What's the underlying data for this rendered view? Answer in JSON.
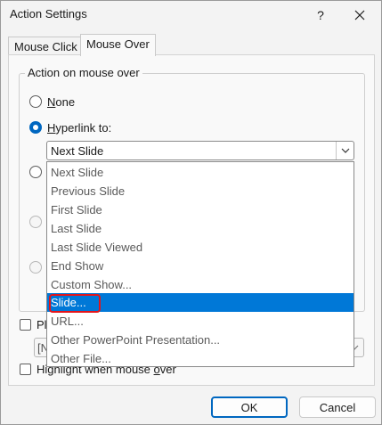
{
  "window": {
    "title": "Action Settings",
    "help_icon": "question-mark-icon",
    "close_icon": "close-icon"
  },
  "tabs": [
    {
      "label": "Mouse Click",
      "active": false
    },
    {
      "label": "Mouse Over",
      "active": true
    }
  ],
  "group": {
    "legend": "Action on mouse over",
    "options": [
      {
        "label": "None",
        "checked": false
      },
      {
        "label": "Hyperlink to:",
        "checked": true
      }
    ],
    "hyperlink_combo": {
      "value": "Next Slide",
      "icon": "chevron-down-icon"
    }
  },
  "dropdown": {
    "items": [
      {
        "label": "Next Slide"
      },
      {
        "label": "Previous Slide"
      },
      {
        "label": "First Slide"
      },
      {
        "label": "Last Slide"
      },
      {
        "label": "Last Slide Viewed"
      },
      {
        "label": "End Show"
      },
      {
        "label": "Custom Show..."
      },
      {
        "label": "Slide...",
        "selected": true
      },
      {
        "label": "URL..."
      },
      {
        "label": "Other PowerPoint Presentation..."
      },
      {
        "label": "Other File..."
      }
    ],
    "highlight_color": "#e3151a",
    "selected_color": "#0078d7"
  },
  "sound": {
    "checkbox_label_visible": "Pl",
    "combo_text": "[N"
  },
  "highlight": {
    "label": "Highlight when mouse over"
  },
  "buttons": {
    "ok": "OK",
    "cancel": "Cancel"
  }
}
